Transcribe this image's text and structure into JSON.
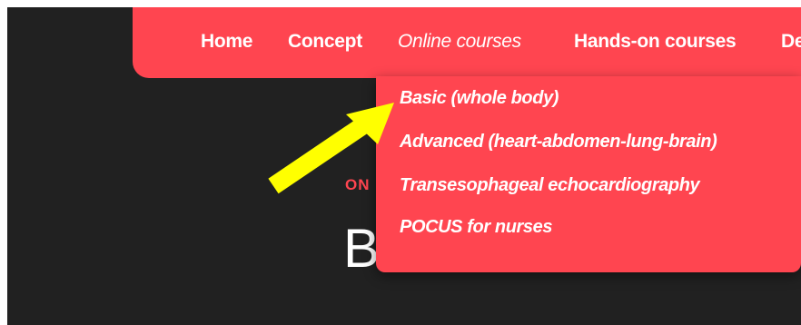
{
  "nav": {
    "items": [
      {
        "label": "Home"
      },
      {
        "label": "Concept"
      },
      {
        "label": "Online courses"
      },
      {
        "label": "Hands-on courses"
      },
      {
        "label": "De"
      }
    ]
  },
  "dropdown": {
    "items": [
      {
        "label": "Basic (whole body)"
      },
      {
        "label": "Advanced (heart-abdomen-lung-brain)"
      },
      {
        "label": "Transesophageal echocardiography"
      },
      {
        "label": "POCUS for nurses"
      }
    ]
  },
  "hero": {
    "subtitle": "ON",
    "title": "B"
  },
  "colors": {
    "accent": "#ff4550",
    "background": "#212121",
    "annotation_arrow": "#ffff00"
  },
  "icons": {
    "annotation": "arrow-icon"
  }
}
